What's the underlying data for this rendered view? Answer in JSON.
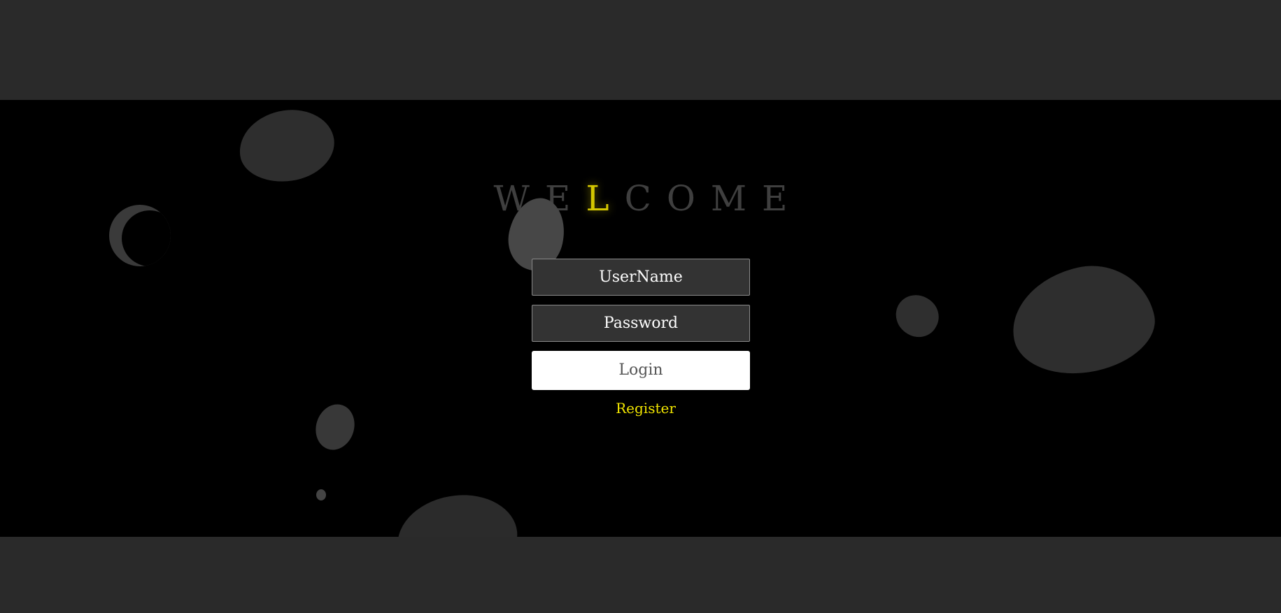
{
  "welcome": {
    "letters": [
      "W",
      "E",
      "L",
      "C",
      "O",
      "M",
      "E"
    ],
    "highlight_index": 2,
    "highlight_color": "#d4c700"
  },
  "form": {
    "username_placeholder": "UserName",
    "password_placeholder": "Password",
    "login_label": "Login",
    "register_label": "Register"
  },
  "colors": {
    "band": "#2a2a2a",
    "stage": "#000000",
    "accent": "#f2e600"
  }
}
